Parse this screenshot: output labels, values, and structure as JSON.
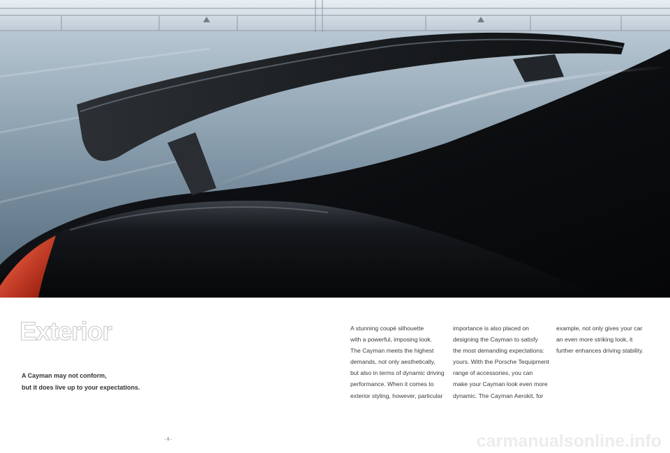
{
  "section_heading": "Exterior",
  "tagline": [
    "A Cayman may not conform,",
    "but it does live up to your expectations."
  ],
  "columns": [
    [
      "A stunning coupé silhouette",
      "with a powerful, imposing look.",
      "The Cayman meets the highest",
      "demands, not only aesthetically,",
      "but also in terms of dynamic driving",
      "performance. When it comes to",
      "exterior styling, however, particular"
    ],
    [
      "importance is also placed on",
      "designing the Cayman to satisfy",
      "the most demanding expectations:",
      "yours. With the Porsche Tequipment",
      "range of accessories, you can",
      "make your Cayman look even more",
      "dynamic. The Cayman Aerokit, for"
    ],
    [
      "example, not only gives your car",
      "an even more striking look, it",
      "further enhances driving stability."
    ]
  ],
  "page_number": "- 6 -",
  "watermark": "carmanualsonline.info",
  "colors": {
    "car_body": "#101216",
    "floor": "#8fa2b0",
    "wall": "#cfd9e2",
    "tail_light": "#c0281c"
  }
}
